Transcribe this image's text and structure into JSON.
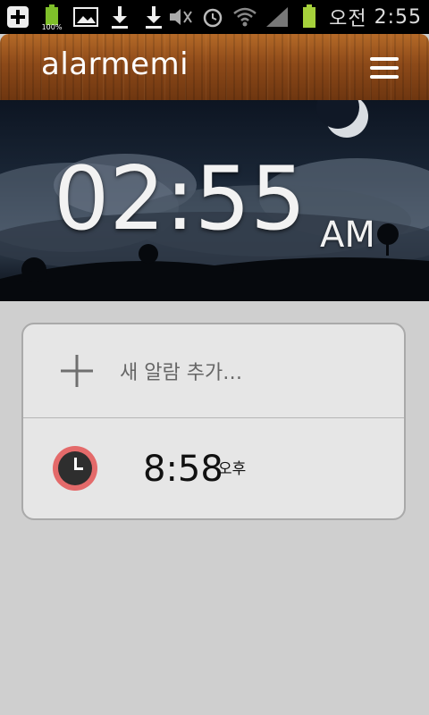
{
  "status_bar": {
    "battery_small_percent": "100%",
    "ampm": "오전",
    "time": "2:55",
    "icons": [
      "add-icon",
      "battery-icon",
      "image-icon",
      "download-icon",
      "download-icon",
      "silent-icon",
      "alarm-icon",
      "wifi-icon",
      "signal-icon",
      "battery-icon"
    ]
  },
  "app": {
    "title": "alarmemi",
    "menu_icon": "hamburger-menu-icon"
  },
  "hero": {
    "clock_time": "02:55",
    "clock_ampm": "AM"
  },
  "alarms": {
    "add_label": "새 알람 추가…",
    "items": [
      {
        "time": "8:58",
        "ampm": "오후",
        "icon": "clock-icon",
        "accent": "#e46a6a"
      }
    ]
  },
  "colors": {
    "accent": "#e46a6a",
    "wood": "#8d4a19",
    "background": "#cfcfcf"
  }
}
